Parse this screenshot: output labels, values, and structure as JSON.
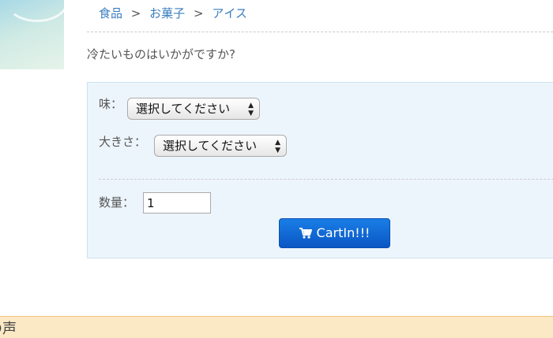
{
  "breadcrumb": {
    "items": [
      "食品",
      "お菓子",
      "アイス"
    ],
    "separator": ">"
  },
  "description": "冷たいものはいかがですか?",
  "options": {
    "flavor_label": "味：",
    "flavor_value": "選択してください",
    "size_label": "大きさ：",
    "size_value": "選択してください"
  },
  "quantity": {
    "label": "数量：",
    "value": "1"
  },
  "cart_button": {
    "label": "CartIn!!!",
    "icon": "cart-icon"
  },
  "footer": {
    "partial_text": "の声"
  },
  "colors": {
    "link": "#3a7ebf",
    "panel_bg": "#edf5fc",
    "button": "#0a56c4",
    "footer_bg": "#fbe9c6"
  }
}
